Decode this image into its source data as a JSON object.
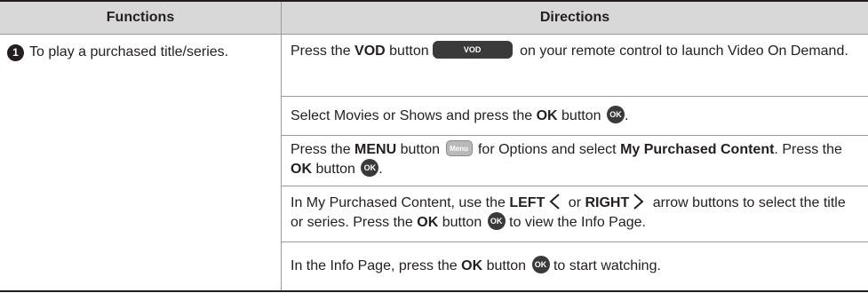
{
  "header": {
    "functions_label": "Functions",
    "directions_label": "Directions"
  },
  "function_row": {
    "number": "1",
    "text": "To play a purchased title/series."
  },
  "buttons": {
    "vod": "VOD",
    "ok": "OK",
    "menu": "Menu"
  },
  "steps": [
    {
      "a": "Press the ",
      "b": "VOD",
      "c": " button",
      "d": " on your remote control to launch Video On Demand."
    },
    {
      "a": "Select Movies or Shows and press the ",
      "b": "OK",
      "c": " button",
      "d": "."
    },
    {
      "a": "Press the ",
      "b": "MENU",
      "c": " button",
      "d": " for Options and select ",
      "e": "My Purchased Content",
      "f": ". Press the ",
      "g": "OK",
      "h": " button",
      "i": "."
    },
    {
      "a": "In My Purchased Content, use the ",
      "b": "LEFT",
      "c": " or ",
      "d": "RIGHT",
      "e": " arrow buttons to select the title or series. Press the ",
      "f": "OK",
      "g": " button",
      "h": " to view the Info Page."
    },
    {
      "a": "In the Info Page, press the ",
      "b": "OK",
      "c": " button",
      "d": " to start watching."
    }
  ],
  "colors": {
    "header_bg": "#d8d8d8",
    "rule": "#231f20",
    "grid": "#9a9a9a",
    "button_dark": "#3a3a3a",
    "button_menu": "#b9b9b9"
  },
  "icons": {
    "left_arrow": "chevron-left-icon",
    "right_arrow": "chevron-right-icon"
  }
}
